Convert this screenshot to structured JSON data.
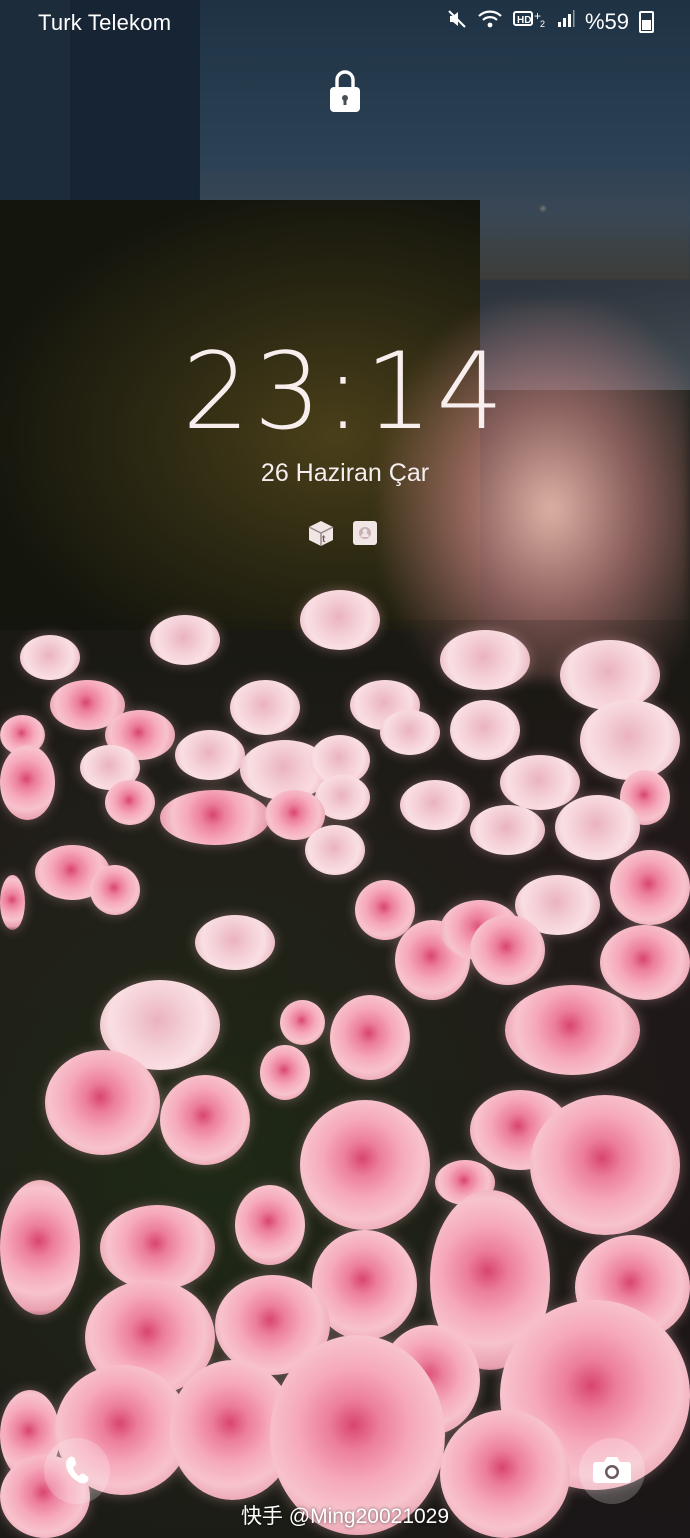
{
  "status_bar": {
    "carrier": "Turk Telekom",
    "battery_label": "%59",
    "icons": [
      "mute-icon",
      "wifi-icon",
      "hd-volte-icon",
      "signal-icon",
      "battery-icon"
    ]
  },
  "lock": {
    "icon": "lock-icon"
  },
  "clock": {
    "time": "23:14",
    "date": "26 Haziran Çar"
  },
  "notifications": {
    "icons": [
      "package-app-icon",
      "contact-app-icon"
    ]
  },
  "shortcuts": {
    "left": "phone-icon",
    "right": "camera-icon"
  },
  "watermark": {
    "text": "快手 @Ming20021029"
  },
  "colors": {
    "clock_text": "#f8eeee",
    "rose_pink": "#f6a9ba",
    "sky": "#2a3f52"
  }
}
